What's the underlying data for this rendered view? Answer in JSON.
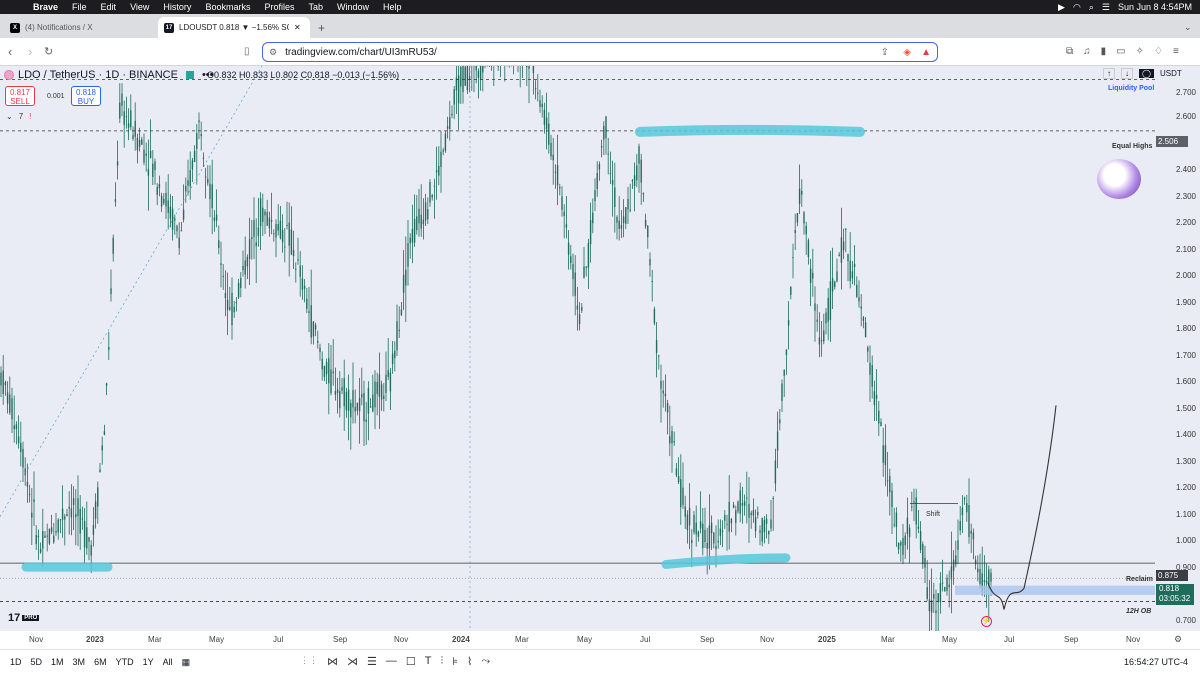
{
  "menubar": {
    "app": "Brave",
    "items": [
      "File",
      "Edit",
      "View",
      "History",
      "Bookmarks",
      "Profiles",
      "Tab",
      "Window",
      "Help"
    ],
    "clock": "Sun Jun 8  4:54PM"
  },
  "tabs": [
    {
      "title": "(4) Notifications / X",
      "favicon": "X"
    },
    {
      "title": "LDOUSDT 0.818 ▼ −1.56% SO",
      "favicon": "17"
    }
  ],
  "address": {
    "url": "tradingview.com/chart/UI3mRU53/"
  },
  "symbol": {
    "title": "LDO / TetherUS · 1D · BINANCE",
    "ohlc": "O0.832  H0.833  L0.802  C0.818  −0.013 (−1.56%)",
    "sell_price": "0.817",
    "sell_label": "SELL",
    "spread": "0.001",
    "buy_price": "0.818",
    "buy_label": "BUY",
    "indicator_count": "7"
  },
  "currency": "USDT",
  "price_axis": [
    "2.700",
    "2.600",
    "2.500",
    "2.400",
    "2.300",
    "2.200",
    "2.100",
    "2.000",
    "1.900",
    "1.800",
    "1.700",
    "1.600",
    "1.500",
    "1.400",
    "1.300",
    "1.200",
    "1.100",
    "1.000",
    "0.900",
    "0.700"
  ],
  "price_tags": {
    "equal_highs": "2.506",
    "reclaim": "0.875",
    "last": "0.818",
    "countdown": "03:05:32"
  },
  "annotations": {
    "liquidity_pool": "Liquidity Pool",
    "equal_highs": "Equal Highs",
    "shift": "Shift",
    "reclaim": "Reclaim",
    "ob": "12H OB"
  },
  "time_axis": [
    "Nov",
    "2023",
    "Mar",
    "May",
    "Jul",
    "Sep",
    "Nov",
    "2024",
    "Mar",
    "May",
    "Jul",
    "Sep",
    "Nov",
    "2025",
    "Mar",
    "May",
    "Jul",
    "Sep",
    "Nov"
  ],
  "bottom": {
    "ranges": [
      "1D",
      "5D",
      "1M",
      "3M",
      "6M",
      "YTD",
      "1Y",
      "All"
    ],
    "clock": "16:54:27 UTC-4"
  },
  "colors": {
    "candle": "#1f6b5c",
    "highlight": "#56c8db",
    "ob_zone": "#a9c4ef",
    "chart_bg": "#e9ecf5",
    "brand_blue": "#2962ff"
  }
}
